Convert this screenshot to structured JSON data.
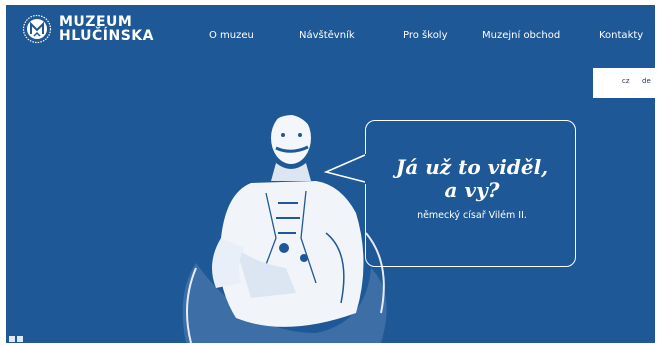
{
  "brand": {
    "line1": "MUZEUM",
    "line2": "HLUČÍNSKA"
  },
  "nav": [
    {
      "label": "O muzeu"
    },
    {
      "label": "Návštěvník"
    },
    {
      "label": "Pro školy"
    },
    {
      "label": "Muzejní obchod"
    },
    {
      "label": "Kontakty"
    }
  ],
  "language": {
    "cz": "cz",
    "de": "de"
  },
  "hero": {
    "quote_line1": "Já už to viděl,",
    "quote_line2": "a vy?",
    "caption": "německý císař Vilém II."
  },
  "colors": {
    "background": "#1f5896",
    "text": "#ffffff"
  }
}
